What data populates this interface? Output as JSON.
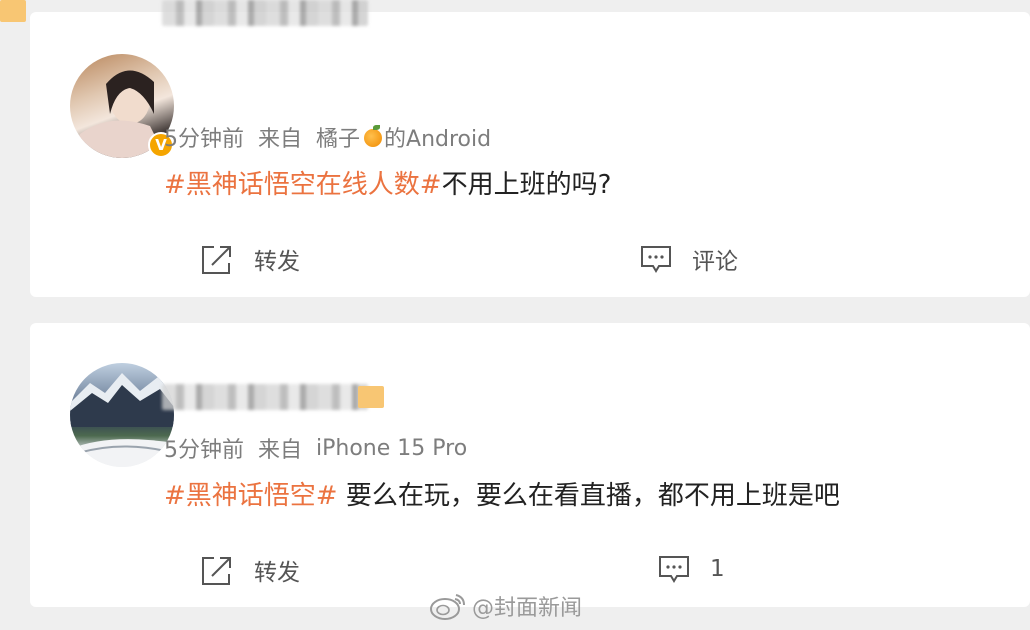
{
  "posts": [
    {
      "verified_badge": "V",
      "time": "5分钟前",
      "source_prefix": "来自",
      "source_name_a": "橘子",
      "source_name_b": "的Android",
      "topic": "#黑神话悟空在线人数#",
      "text": "不用上班的吗?",
      "repost_label": "转发",
      "comment_label": "评论"
    },
    {
      "time": "5分钟前",
      "source_prefix": "来自",
      "source_name": "iPhone 15 Pro",
      "topic": "#黑神话悟空#",
      "text": " 要么在玩，要么在看直播，都不用上班是吧",
      "repost_label": "转发",
      "comment_count": "1"
    }
  ],
  "watermark": "@封面新闻",
  "icons": {
    "repost": "share-arrow-icon",
    "comment": "comment-bubble-icon",
    "verified": "verified-v-icon",
    "source": "orange-fruit-icon",
    "watermark": "weibo-logo-icon"
  },
  "colors": {
    "topic": "#eb7340",
    "verified": "#f5a500",
    "background": "#efefef"
  }
}
